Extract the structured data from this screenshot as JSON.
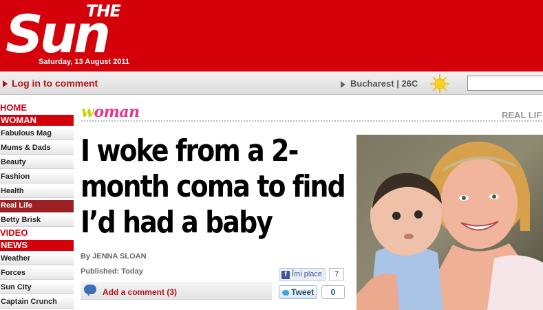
{
  "masthead": {
    "logo_the": "THE",
    "logo_sun": "Sun",
    "date": "Saturday, 13 August 2011",
    "brand_color": "#d4000a"
  },
  "utility_bar": {
    "login_label": "Log in to comment",
    "weather_label": "Bucharest | 26C",
    "weather_icon": "sun-icon",
    "search": {
      "value": "",
      "placeholder": ""
    }
  },
  "nav": {
    "home": "HOME",
    "woman": "WOMAN",
    "woman_items": [
      {
        "label": "Fabulous Mag"
      },
      {
        "label": "Mums & Dads"
      },
      {
        "label": "Beauty"
      },
      {
        "label": "Fashion"
      },
      {
        "label": "Health"
      },
      {
        "label": "Real Life",
        "active": true
      },
      {
        "label": "Betty Brisk"
      }
    ],
    "video": "VIDEO",
    "news": "NEWS",
    "news_items": [
      {
        "label": "Weather"
      },
      {
        "label": "Forces"
      },
      {
        "label": "Sun City"
      },
      {
        "label": "Captain Crunch"
      }
    ]
  },
  "section": {
    "logo_initial": "w",
    "logo_rest": "oman",
    "related_label": "REAL LIF"
  },
  "article": {
    "headline": "I woke from a 2-month coma to find I’d had a baby",
    "byline": "By JENNA SLOAN",
    "published": "Published: Today",
    "comment_link": "Add a comment (3)"
  },
  "social": {
    "facebook_label": "Îmi place",
    "facebook_count": "7",
    "tweet_label": "Tweet",
    "tweet_count": "0"
  },
  "photo": {
    "icon": "photo-mother-and-baby"
  }
}
